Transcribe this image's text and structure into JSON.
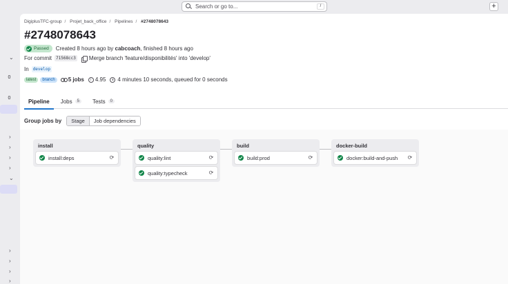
{
  "search": {
    "placeholder": "Search or go to...",
    "shortcut": "/"
  },
  "sidebar": {
    "count_a": "0",
    "count_b": "0"
  },
  "breadcrumb": [
    "DigiplusTFC-group",
    "Projet_back_office",
    "Pipelines",
    "#2748078643"
  ],
  "page": {
    "title": "#2748078643",
    "status": "Passed",
    "created_prefix": "Created 8 hours ago by",
    "author": "cabcoach",
    "finished": ", finished 8 hours ago",
    "for_commit": "For commit",
    "commit_sha": "71568cc3",
    "commit_message": "Merge branch 'feature/disponibilités' into 'develop'",
    "in_label": "In",
    "ref": "develop",
    "tag_latest": "latest",
    "tag_branch": "branch",
    "jobs_count": "5 jobs",
    "score": "4.95",
    "duration": "4 minutes 10 seconds, queued for 0 seconds"
  },
  "tabs": [
    {
      "label": "Pipeline",
      "count": ""
    },
    {
      "label": "Jobs",
      "count": "5"
    },
    {
      "label": "Tests",
      "count": "0"
    }
  ],
  "groupby": {
    "label": "Group jobs by",
    "stage": "Stage",
    "deps": "Job dependencies"
  },
  "stages": [
    {
      "name": "install",
      "jobs": [
        "install:deps"
      ]
    },
    {
      "name": "quality",
      "jobs": [
        "quality:lint",
        "quality:typecheck"
      ]
    },
    {
      "name": "build",
      "jobs": [
        "build:prod"
      ]
    },
    {
      "name": "docker-build",
      "jobs": [
        "docker:build-and-push"
      ]
    }
  ],
  "colors": {
    "success": "#108548",
    "accent": "#1f75cb"
  }
}
